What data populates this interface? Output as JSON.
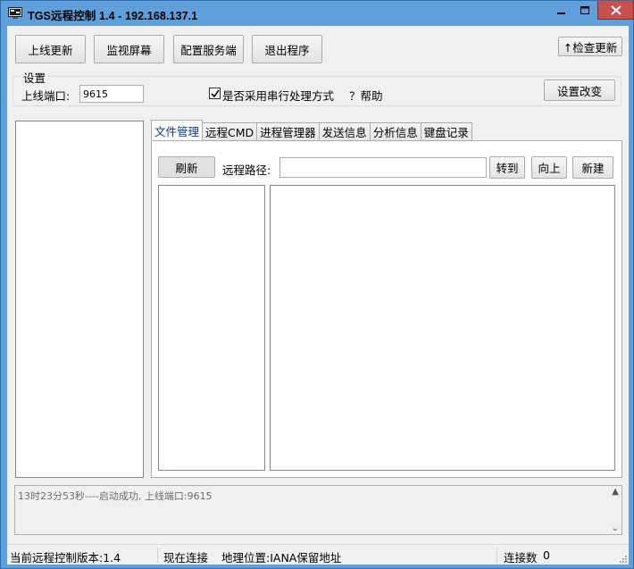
{
  "window": {
    "title": "TGS远程控制 1.4 - 192.168.137.1",
    "icons": [
      "app-icon",
      "minimize-icon",
      "maximize-icon",
      "close-icon"
    ]
  },
  "toolbar": {
    "online_update": "上线更新",
    "monitor_screen": "监视屏幕",
    "config_server": "配置服务端",
    "exit_program": "退出程序",
    "check_update": "↑检查更新"
  },
  "settings": {
    "group_label": "设置",
    "port_label": "上线端口:",
    "port_value": "9615",
    "serial_label": "是否采用串行处理方式",
    "serial_checked": true,
    "help_label": "？帮助",
    "apply_button": "设置改变"
  },
  "tabs": {
    "items": [
      {
        "label": "文件管理",
        "active": true
      },
      {
        "label": "远程CMD",
        "active": false
      },
      {
        "label": "进程管理器",
        "active": false
      },
      {
        "label": "发送信息",
        "active": false
      },
      {
        "label": "分析信息",
        "active": false
      },
      {
        "label": "键盘记录",
        "active": false
      }
    ]
  },
  "file_manager": {
    "refresh": "刷新",
    "path_label": "远程路径:",
    "path_value": "",
    "goto": "转到",
    "up": "向上",
    "new": "新建"
  },
  "log": {
    "lines": [
      "13时23分53秒----启动成功, 上线端口:9615"
    ]
  },
  "status": {
    "version": "当前远程控制版本:1.4",
    "connected_now": "现在连接",
    "location": "地理位置:IANA保留地址",
    "connection_count_label": "连接数",
    "connection_count": "0"
  },
  "colors": {
    "titlebar": "#5fa0dc",
    "close_button": "#c7504a",
    "window_bg": "#f0f0f0"
  }
}
